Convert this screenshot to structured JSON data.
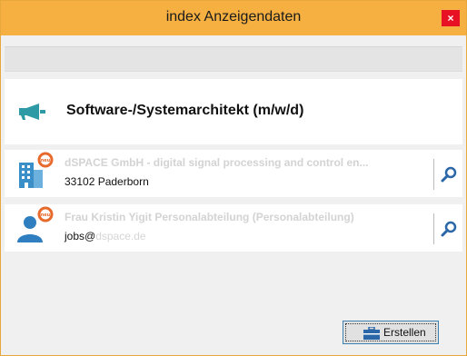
{
  "window": {
    "title": "index Anzeigendaten",
    "close_label": "×"
  },
  "job": {
    "title": "Software-/Systemarchitekt (m/w/d)"
  },
  "cards": [
    {
      "name": "dSPACE GmbH - digital signal processing and control en...",
      "detail": "33102 Paderborn",
      "icon": "building-icon",
      "badge": "neu"
    },
    {
      "name": "Frau Kristin Yigit Personalabteilung (Personalabteilung)",
      "detail_prefix": "jobs@",
      "detail_suffix": "dspace.de",
      "icon": "person-icon",
      "badge": "neu"
    }
  ],
  "footer": {
    "create_label": "Erstellen"
  },
  "colors": {
    "titlebar": "#f5b041",
    "accent_teal": "#2e9aa6",
    "badge_orange": "#e8692c",
    "search_blue": "#2a66a8"
  }
}
